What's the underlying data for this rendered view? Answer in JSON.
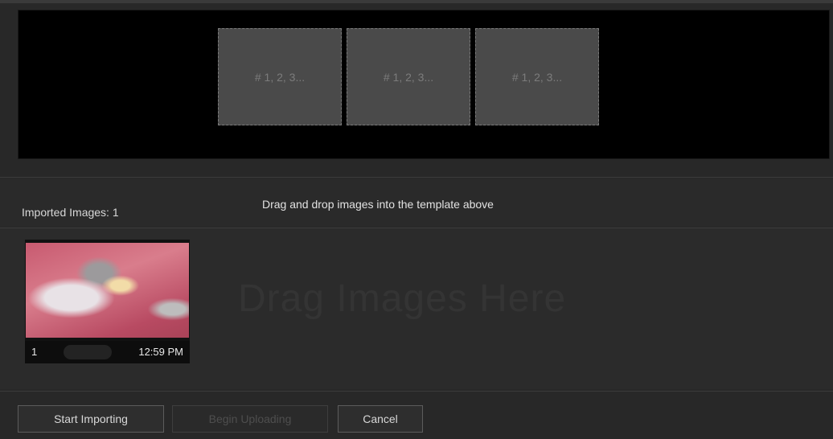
{
  "template": {
    "slots": [
      {
        "label": "# 1, 2, 3..."
      },
      {
        "label": "# 1, 2, 3..."
      },
      {
        "label": "# 1, 2, 3..."
      }
    ]
  },
  "header": {
    "imported_label": "Imported Images: 1",
    "instruction": "Drag and drop images into the template above"
  },
  "drop_zone": {
    "watermark": "Drag Images Here"
  },
  "thumbnails": [
    {
      "index": "1",
      "time": "12:59 PM"
    }
  ],
  "footer": {
    "start_importing": "Start Importing",
    "begin_uploading": "Begin Uploading",
    "cancel": "Cancel"
  }
}
